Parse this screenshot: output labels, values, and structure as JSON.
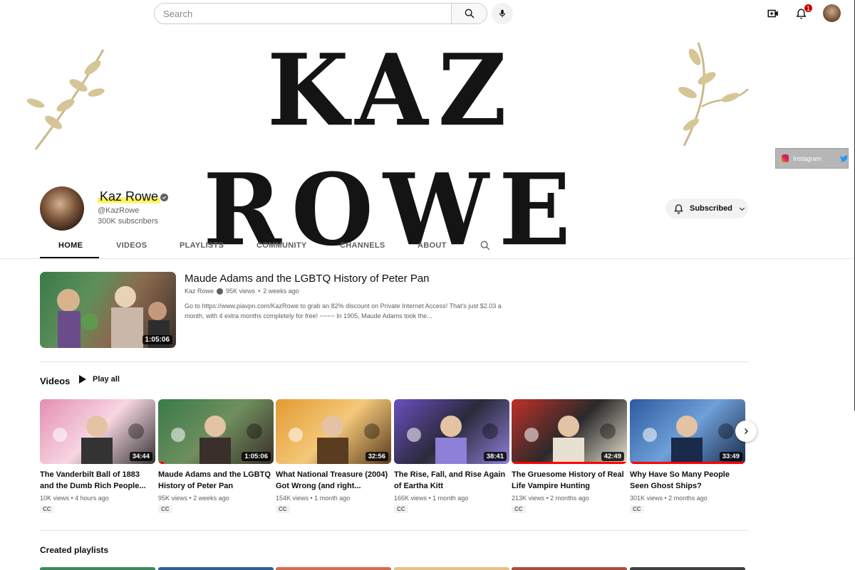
{
  "topbar": {
    "search_placeholder": "Search",
    "notification_count": "1",
    "icons": [
      "search-icon",
      "mic-icon",
      "create-video-icon",
      "bell-icon",
      "account-avatar"
    ]
  },
  "banner": {
    "art_text": "KAZ ROWE",
    "links": {
      "instagram": "Instagram"
    }
  },
  "channel": {
    "name": "Kaz Rowe",
    "handle": "@KazRowe",
    "subscribers": "300K subscribers",
    "subscribe_label": "Subscribed"
  },
  "tabs": [
    "HOME",
    "VIDEOS",
    "PLAYLISTS",
    "COMMUNITY",
    "CHANNELS",
    "ABOUT"
  ],
  "featured": {
    "title": "Maude Adams and the LGBTQ History of Peter Pan",
    "channel": "Kaz Rowe",
    "views": "95K views",
    "age": "2 weeks ago",
    "description": "Go to https://www.piavpn.com/KazRowe to grab an 82% discount on Private Internet Access! That's just $2.03 a month, with 4 extra months completely for free! ~~~~ In 1905, Maude Adams took the...",
    "duration": "1:05:06"
  },
  "videos_shelf": {
    "title": "Videos",
    "play_all": "Play all",
    "items": [
      {
        "title": "The Vanderbilt Ball of 1883 and the Dumb Rich People...",
        "meta": "10K views • 4 hours ago",
        "duration": "34:44",
        "cc": "CC",
        "colors": [
          "#e48fb0",
          "#f7d6e2",
          "#333333"
        ],
        "progress": 0
      },
      {
        "title": "Maude Adams and the LGBTQ History of Peter Pan",
        "meta": "95K views • 2 weeks ago",
        "duration": "1:05:06",
        "cc": "CC",
        "colors": [
          "#3a7a4a",
          "#6f8f5e",
          "#3a2f2a"
        ],
        "progress": 0.05
      },
      {
        "title": "What National Treasure (2004) Got Wrong (and right...",
        "meta": "154K views • 1 month ago",
        "duration": "32:56",
        "cc": "CC",
        "colors": [
          "#e39a32",
          "#f4c87a",
          "#5a3c1e"
        ],
        "progress": 0
      },
      {
        "title": "The Rise, Fall, and Rise Again of Eartha Kitt",
        "meta": "166K views • 1 month ago",
        "duration": "38:41",
        "cc": "CC",
        "colors": [
          "#6a4fc0",
          "#2a2a3a",
          "#8e7fd8"
        ],
        "progress": 0
      },
      {
        "title": "The Gruesome History of Real Life Vampire Hunting",
        "meta": "213K views • 2 months ago",
        "duration": "42:49",
        "cc": "CC",
        "colors": [
          "#c0302a",
          "#2a2a2a",
          "#e8e0d0"
        ],
        "progress": 1.0
      },
      {
        "title": "Why Have So Many People Seen Ghost Ships?",
        "meta": "301K views • 2 months ago",
        "duration": "33:49",
        "cc": "CC",
        "colors": [
          "#2c5aa0",
          "#6fa0d8",
          "#1a2a4a"
        ],
        "progress": 1.0
      }
    ]
  },
  "playlists": {
    "title": "Created playlists",
    "strip_colors": [
      "#3a8a5a",
      "#2b5fa0",
      "#d86a4a",
      "#e8c080",
      "#b04a3a",
      "#404040"
    ]
  }
}
